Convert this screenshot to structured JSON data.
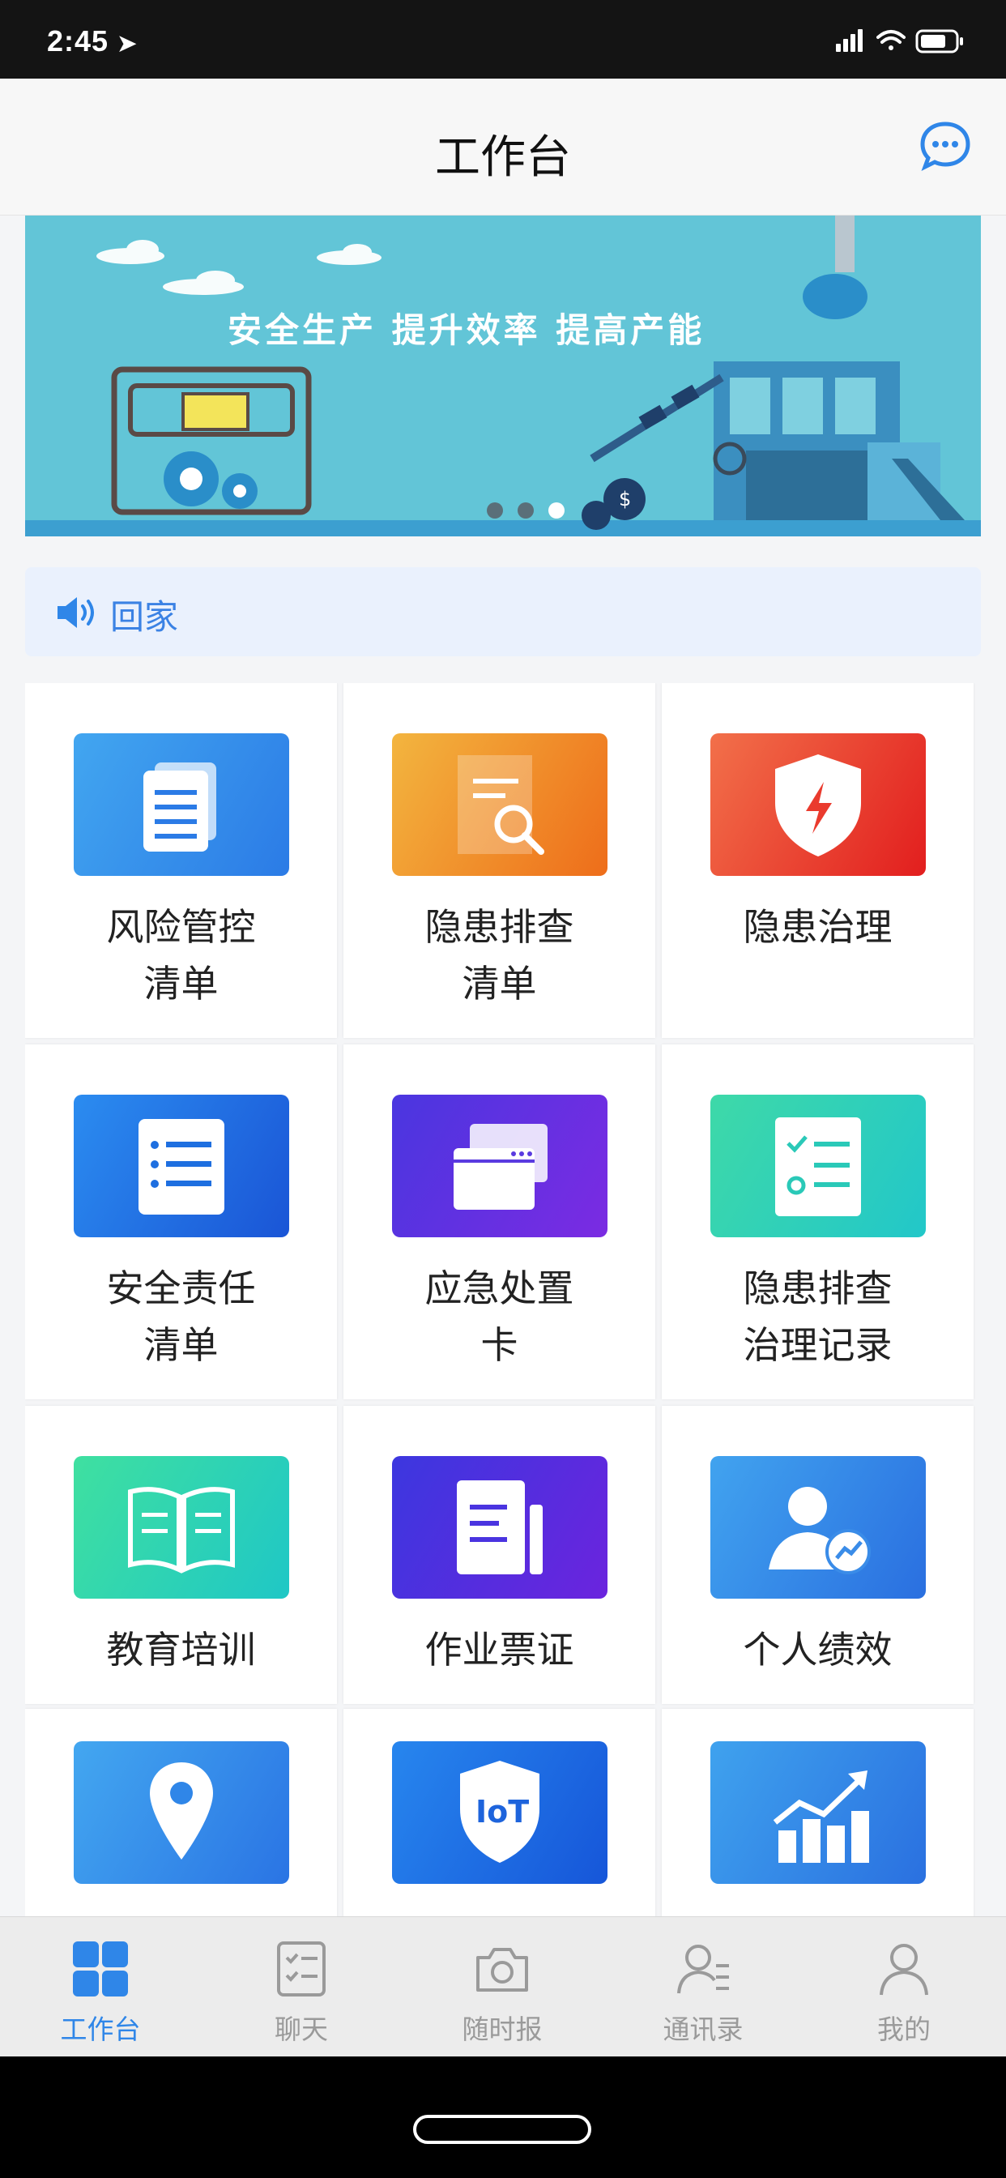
{
  "status_bar": {
    "time": "2:45"
  },
  "header": {
    "title": "工作台"
  },
  "banner": {
    "slogan": "安全生产  提升效率  提高产能",
    "slides": 3,
    "active_slide": 3
  },
  "notice": {
    "text": "回家"
  },
  "grid": [
    {
      "label1": "风险管控",
      "label2": "清单",
      "icon": "documents-icon",
      "colors": [
        "#42a6f0",
        "#2b7be6"
      ]
    },
    {
      "label1": "隐患排查",
      "label2": "清单",
      "icon": "document-search-icon",
      "colors": [
        "#f3b53f",
        "#ee6d1a"
      ]
    },
    {
      "label1": "隐患治理",
      "label2": "",
      "icon": "shield-lightning-icon",
      "colors": [
        "#f2704a",
        "#e21e1e"
      ]
    },
    {
      "label1": "安全责任",
      "label2": "清单",
      "icon": "list-icon",
      "colors": [
        "#2b8cf0",
        "#1a55d6"
      ]
    },
    {
      "label1": "应急处置",
      "label2": "卡",
      "icon": "windows-icon",
      "colors": [
        "#4a36e0",
        "#7b2be2"
      ]
    },
    {
      "label1": "隐患排查",
      "label2": "治理记录",
      "icon": "checklist-icon",
      "colors": [
        "#3ed9a8",
        "#22c7c9"
      ]
    },
    {
      "label1": "教育培训",
      "label2": "",
      "icon": "book-icon",
      "colors": [
        "#3fe0a0",
        "#1fc7c6"
      ]
    },
    {
      "label1": "作业票证",
      "label2": "",
      "icon": "ticket-icon",
      "colors": [
        "#3c37df",
        "#6b24de"
      ]
    },
    {
      "label1": "个人绩效",
      "label2": "",
      "icon": "user-growth-icon",
      "colors": [
        "#41a3ef",
        "#2a6fe0"
      ]
    },
    {
      "label1": "",
      "label2": "",
      "icon": "location-pin-icon",
      "colors": [
        "#43a7f0",
        "#2a74e4"
      ]
    },
    {
      "label1": "",
      "label2": "",
      "icon": "iot-shield-icon",
      "colors": [
        "#2786ee",
        "#1656d9"
      ]
    },
    {
      "label1": "",
      "label2": "",
      "icon": "growth-chart-icon",
      "colors": [
        "#3fa2ee",
        "#2a70e0"
      ]
    }
  ],
  "tabbar": [
    {
      "label": "工作台",
      "icon": "grid-icon",
      "active": true
    },
    {
      "label": "聊天",
      "icon": "chat-checklist-icon",
      "active": false
    },
    {
      "label": "随时报",
      "icon": "camera-icon",
      "active": false
    },
    {
      "label": "通讯录",
      "icon": "contacts-icon",
      "active": false
    },
    {
      "label": "我的",
      "icon": "user-icon",
      "active": false
    }
  ],
  "colors": {
    "accent": "#2f86e8",
    "inactive": "#9a9a9a"
  }
}
